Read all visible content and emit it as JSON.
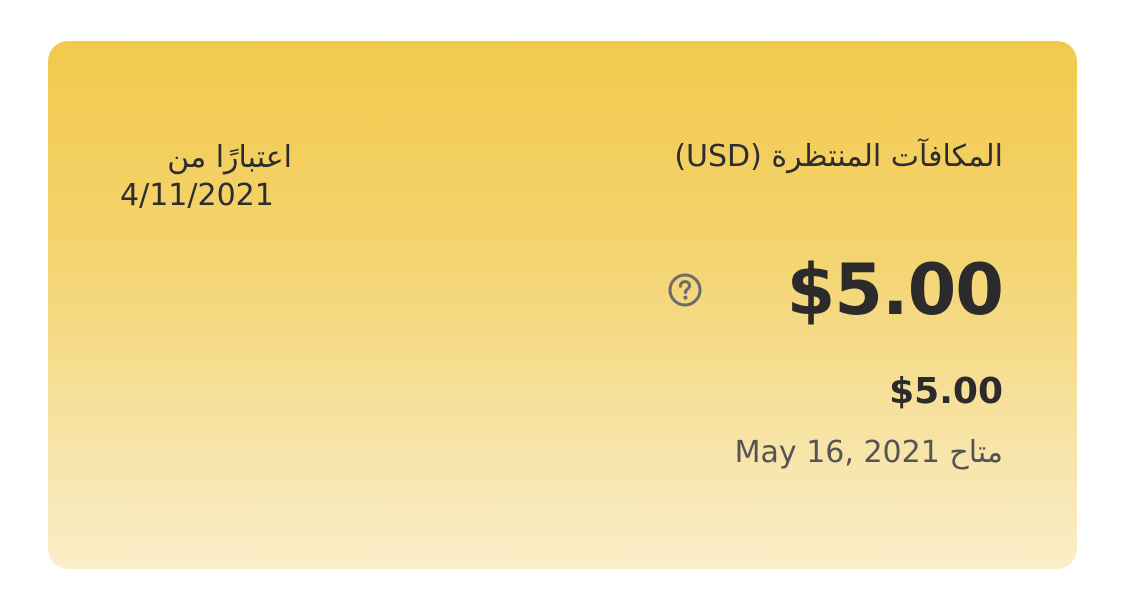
{
  "card": {
    "title": "المكافآت المنتظرة (USD)",
    "as_of_label": "اعتبارًا من",
    "as_of_date": "4/11/2021",
    "amount_large": "$5.00",
    "help_icon": "question-circle-icon",
    "amount_small": "$5.00",
    "available_label": "متاح",
    "available_date": "May 16, 2021"
  },
  "colors": {
    "gradient_top": "#f2c94c",
    "gradient_bottom": "#faeec9",
    "text_primary": "#2b2b2b",
    "text_secondary": "#555555",
    "icon": "#6b6b6b"
  }
}
